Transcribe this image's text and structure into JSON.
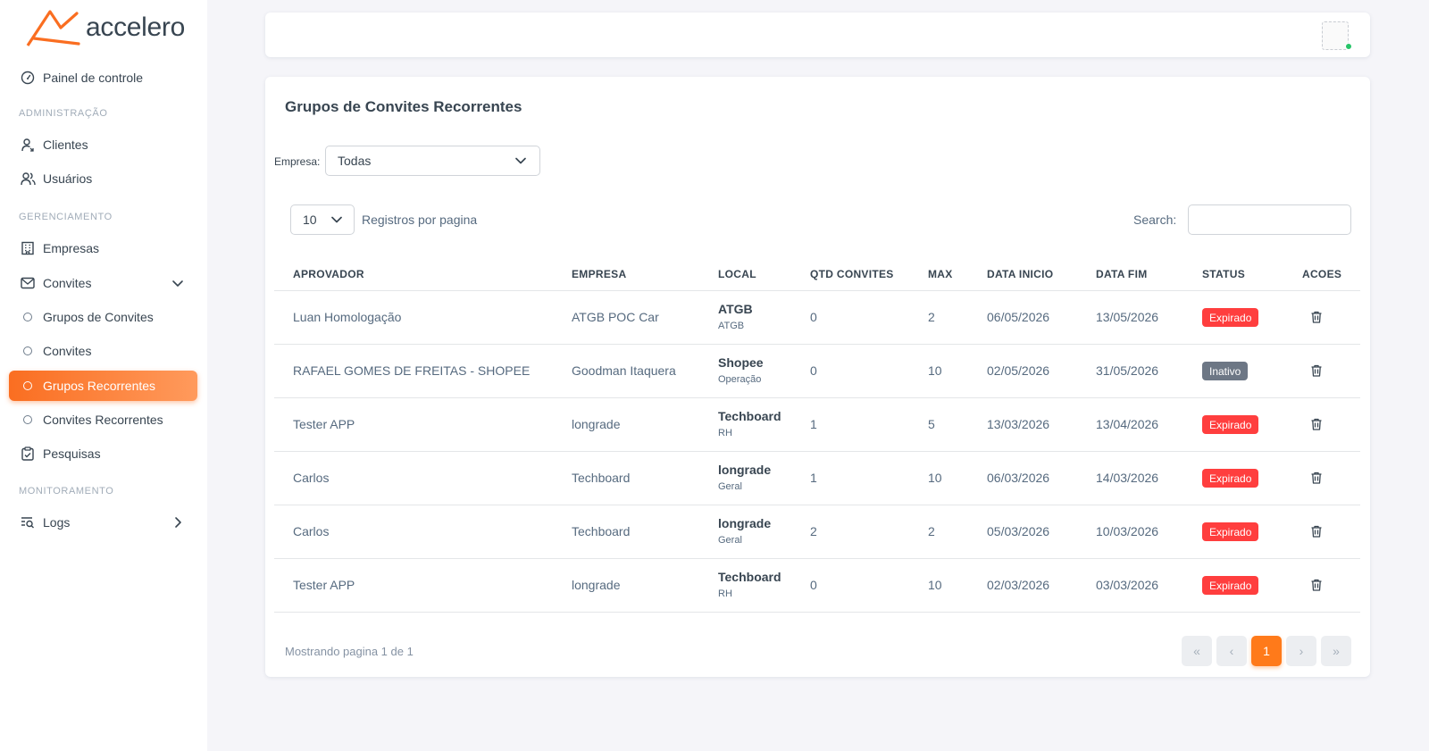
{
  "brand": {
    "name": "accelero",
    "accent": "#fa6e21"
  },
  "sidebar": {
    "dashboard": {
      "label": "Painel de controle",
      "icon": "gauge-icon"
    },
    "section_admin": "ADMINISTRAÇÃO",
    "clientes": {
      "label": "Clientes",
      "icon": "user-icon"
    },
    "usuarios": {
      "label": "Usuários",
      "icon": "users-icon"
    },
    "section_management": "GERENCIAMENTO",
    "empresas": {
      "label": "Empresas",
      "icon": "building-icon"
    },
    "convites": {
      "label": "Convites",
      "icon": "mail-icon"
    },
    "grupos_convites": {
      "label": "Grupos de Convites"
    },
    "convites_sub": {
      "label": "Convites"
    },
    "grupos_recorrentes": {
      "label": "Grupos Recorrentes",
      "active": true
    },
    "convites_recorrentes": {
      "label": "Convites Recorrentes"
    },
    "pesquisas": {
      "label": "Pesquisas",
      "icon": "clipboard-icon"
    },
    "section_monitoring": "MONITORAMENTO",
    "logs": {
      "label": "Logs",
      "icon": "list-search-icon"
    }
  },
  "main": {
    "title": "Grupos de Convites Recorrentes",
    "filter_label": "Empresa:",
    "filter_value": "Todas",
    "page_size": "10",
    "page_size_label": "Registros por pagina",
    "search_label": "Search:",
    "search_value": "",
    "footer_info": "Mostrando pagina 1 de 1",
    "current_page": "1"
  },
  "table": {
    "columns": [
      "APROVADOR",
      "EMPRESA",
      "LOCAL",
      "QTD CONVITES",
      "MAX",
      "DATA INICIO",
      "DATA FIM",
      "STATUS",
      "ACOES"
    ],
    "rows": [
      {
        "aprovador": "Luan Homologação",
        "empresa": "ATGB POC Car",
        "local": "ATGB",
        "local_sub": "ATGB",
        "qtd": "0",
        "max": "2",
        "inicio": "06/05/2026",
        "fim": "13/05/2026",
        "status": "Expirado"
      },
      {
        "aprovador": "RAFAEL GOMES DE FREITAS - SHOPEE",
        "empresa": "Goodman Itaquera",
        "local": "Shopee",
        "local_sub": "Operação",
        "qtd": "0",
        "max": "10",
        "inicio": "02/05/2026",
        "fim": "31/05/2026",
        "status": "Inativo"
      },
      {
        "aprovador": "Tester APP",
        "empresa": "longrade",
        "local": "Techboard",
        "local_sub": "RH",
        "qtd": "1",
        "max": "5",
        "inicio": "13/03/2026",
        "fim": "13/04/2026",
        "status": "Expirado"
      },
      {
        "aprovador": "Carlos",
        "empresa": "Techboard",
        "local": "longrade",
        "local_sub": "Geral",
        "qtd": "1",
        "max": "10",
        "inicio": "06/03/2026",
        "fim": "14/03/2026",
        "status": "Expirado"
      },
      {
        "aprovador": "Carlos",
        "empresa": "Techboard",
        "local": "longrade",
        "local_sub": "Geral",
        "qtd": "2",
        "max": "2",
        "inicio": "05/03/2026",
        "fim": "10/03/2026",
        "status": "Expirado"
      },
      {
        "aprovador": "Tester APP",
        "empresa": "longrade",
        "local": "Techboard",
        "local_sub": "RH",
        "qtd": "0",
        "max": "10",
        "inicio": "02/03/2026",
        "fim": "03/03/2026",
        "status": "Expirado"
      }
    ]
  },
  "pagination": {
    "first": "«",
    "prev": "‹",
    "next": "›",
    "last": "»"
  },
  "colors": {
    "expired": "#ff3e3e",
    "inactive": "#6d7785",
    "active_page": "#ff7a1a"
  }
}
